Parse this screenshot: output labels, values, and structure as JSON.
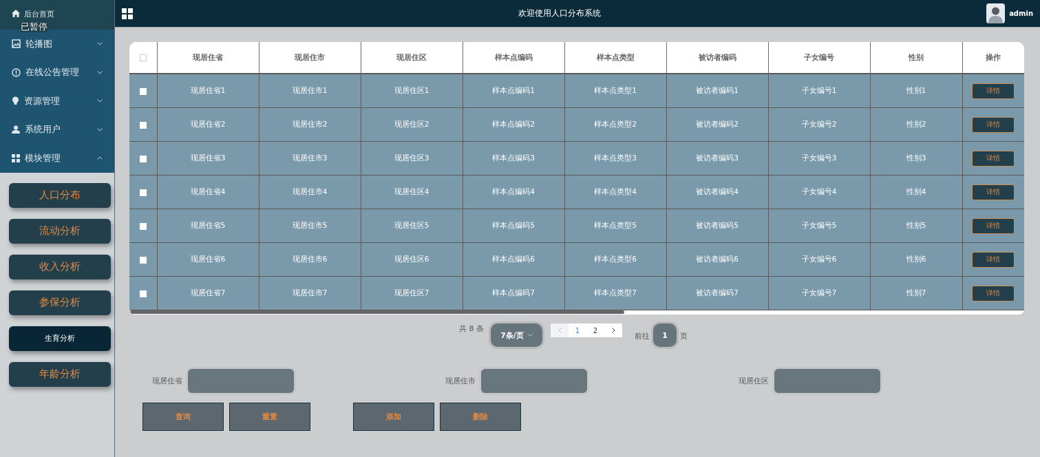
{
  "header": {
    "home_label": "后台首页",
    "title": "欢迎使用人口分布系统",
    "user": "admin"
  },
  "overlay_text": "已暂停",
  "menu": [
    {
      "label": "轮播图",
      "expanded": false
    },
    {
      "label": "在线公告管理",
      "expanded": false
    },
    {
      "label": "资源管理",
      "expanded": false
    },
    {
      "label": "系统用户",
      "expanded": false
    },
    {
      "label": "模块管理",
      "expanded": true,
      "children": [
        {
          "label": "人口分布",
          "selected": false
        },
        {
          "label": "流动分析",
          "selected": false
        },
        {
          "label": "收入分析",
          "selected": false
        },
        {
          "label": "参保分析",
          "selected": false
        },
        {
          "label": "生育分析",
          "selected": true
        },
        {
          "label": "年龄分析",
          "selected": false
        }
      ]
    }
  ],
  "table": {
    "select_all_checked": false,
    "columns": [
      "现居住省",
      "现居住市",
      "现居住区",
      "样本点编码",
      "样本点类型",
      "被访者编码",
      "子女编号",
      "性别",
      "操作"
    ],
    "rows": [
      {
        "checked": false,
        "cells": [
          "现居住省1",
          "现居住市1",
          "现居住区1",
          "样本点编码1",
          "样本点类型1",
          "被访者编码1",
          "子女编号1",
          "性别1"
        ],
        "action": "详情"
      },
      {
        "checked": false,
        "cells": [
          "现居住省2",
          "现居住市2",
          "现居住区2",
          "样本点编码2",
          "样本点类型2",
          "被访者编码2",
          "子女编号2",
          "性别2"
        ],
        "action": "详情"
      },
      {
        "checked": false,
        "cells": [
          "现居住省3",
          "现居住市3",
          "现居住区3",
          "样本点编码3",
          "样本点类型3",
          "被访者编码3",
          "子女编号3",
          "性别3"
        ],
        "action": "详情"
      },
      {
        "checked": false,
        "cells": [
          "现居住省4",
          "现居住市4",
          "现居住区4",
          "样本点编码4",
          "样本点类型4",
          "被访者编码4",
          "子女编号4",
          "性别4"
        ],
        "action": "详情"
      },
      {
        "checked": false,
        "cells": [
          "现居住省5",
          "现居住市5",
          "现居住区5",
          "样本点编码5",
          "样本点类型5",
          "被访者编码5",
          "子女编号5",
          "性别5"
        ],
        "action": "详情"
      },
      {
        "checked": false,
        "cells": [
          "现居住省6",
          "现居住市6",
          "现居住区6",
          "样本点编码6",
          "样本点类型6",
          "被访者编码6",
          "子女编号6",
          "性别6"
        ],
        "action": "详情"
      },
      {
        "checked": false,
        "cells": [
          "现居住省7",
          "现居住市7",
          "现居住区7",
          "样本点编码7",
          "样本点类型7",
          "被访者编码7",
          "子女编号7",
          "性别7"
        ],
        "action": "详情"
      }
    ]
  },
  "pagination": {
    "total": "共 8 条",
    "page_size": "7条/页",
    "pages": [
      {
        "label": "1",
        "selected": true
      },
      {
        "label": "2",
        "selected": false
      }
    ],
    "goto_label": "前往",
    "goto_value": "1",
    "goto_suffix": "页"
  },
  "search": {
    "fields": [
      {
        "label": "现居住省"
      },
      {
        "label": "现居住市"
      },
      {
        "label": "现居住区"
      }
    ],
    "buttons": [
      "查询",
      "重置",
      "添加",
      "删除"
    ]
  }
}
